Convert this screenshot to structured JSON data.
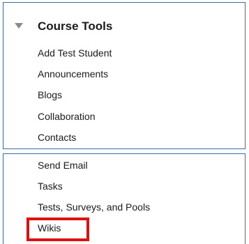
{
  "course_tools": {
    "title": "Course Tools",
    "expanded_icon": "triangle-down-icon",
    "items_top": [
      {
        "label": "Add Test Student"
      },
      {
        "label": "Announcements"
      },
      {
        "label": "Blogs"
      },
      {
        "label": "Collaboration"
      },
      {
        "label": "Contacts"
      }
    ],
    "items_bottom": [
      {
        "label": "Send Email"
      },
      {
        "label": "Tasks"
      },
      {
        "label": "Tests, Surveys, and Pools"
      },
      {
        "label": "Wikis"
      }
    ]
  },
  "highlight": {
    "target": "Wikis",
    "color": "#e01010"
  },
  "colors": {
    "panel_border": "#3b6ea3",
    "triangle": "#8a8a8a",
    "text": "#1a1a1a"
  }
}
